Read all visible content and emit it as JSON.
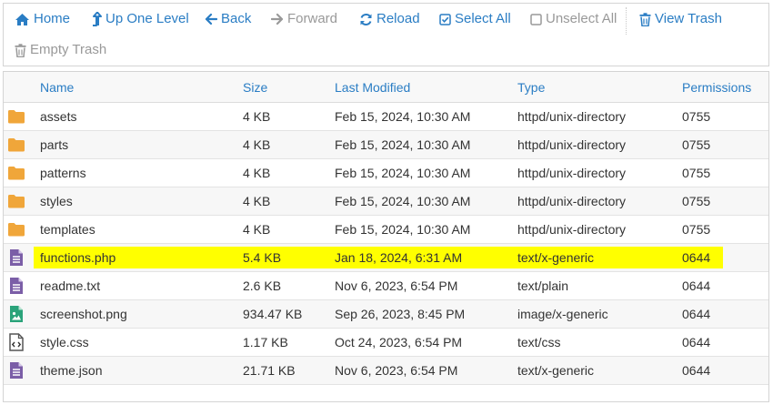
{
  "toolbar": {
    "home": "Home",
    "up": "Up One Level",
    "back": "Back",
    "forward": "Forward",
    "reload": "Reload",
    "select_all": "Select All",
    "unselect_all": "Unselect All",
    "view_trash": "View Trash",
    "empty_trash": "Empty Trash"
  },
  "colors": {
    "link": "#2a7dc4",
    "disabled": "#999999",
    "folder": "#f0a63a",
    "file_generic": "#7b5ea7",
    "file_image": "#2aa37a",
    "highlight": "#ffff00"
  },
  "table": {
    "columns": {
      "name": "Name",
      "size": "Size",
      "modified": "Last Modified",
      "type": "Type",
      "permissions": "Permissions"
    },
    "rows": [
      {
        "icon": "folder-icon",
        "name": "assets",
        "size": "4 KB",
        "modified": "Feb 15, 2024, 10:30 AM",
        "type": "httpd/unix-directory",
        "perm": "0755"
      },
      {
        "icon": "folder-icon",
        "name": "parts",
        "size": "4 KB",
        "modified": "Feb 15, 2024, 10:30 AM",
        "type": "httpd/unix-directory",
        "perm": "0755"
      },
      {
        "icon": "folder-icon",
        "name": "patterns",
        "size": "4 KB",
        "modified": "Feb 15, 2024, 10:30 AM",
        "type": "httpd/unix-directory",
        "perm": "0755"
      },
      {
        "icon": "folder-icon",
        "name": "styles",
        "size": "4 KB",
        "modified": "Feb 15, 2024, 10:30 AM",
        "type": "httpd/unix-directory",
        "perm": "0755"
      },
      {
        "icon": "folder-icon",
        "name": "templates",
        "size": "4 KB",
        "modified": "Feb 15, 2024, 10:30 AM",
        "type": "httpd/unix-directory",
        "perm": "0755"
      },
      {
        "icon": "text-file-icon",
        "name": "functions.php",
        "size": "5.4 KB",
        "modified": "Jan 18, 2024, 6:31 AM",
        "type": "text/x-generic",
        "perm": "0644",
        "highlighted": true
      },
      {
        "icon": "text-file-icon",
        "name": "readme.txt",
        "size": "2.6 KB",
        "modified": "Nov 6, 2023, 6:54 PM",
        "type": "text/plain",
        "perm": "0644"
      },
      {
        "icon": "image-file-icon",
        "name": "screenshot.png",
        "size": "934.47 KB",
        "modified": "Sep 26, 2023, 8:45 PM",
        "type": "image/x-generic",
        "perm": "0644"
      },
      {
        "icon": "code-file-icon",
        "name": "style.css",
        "size": "1.17 KB",
        "modified": "Oct 24, 2023, 6:54 PM",
        "type": "text/css",
        "perm": "0644"
      },
      {
        "icon": "text-file-icon",
        "name": "theme.json",
        "size": "21.71 KB",
        "modified": "Nov 6, 2023, 6:54 PM",
        "type": "text/x-generic",
        "perm": "0644"
      }
    ]
  }
}
